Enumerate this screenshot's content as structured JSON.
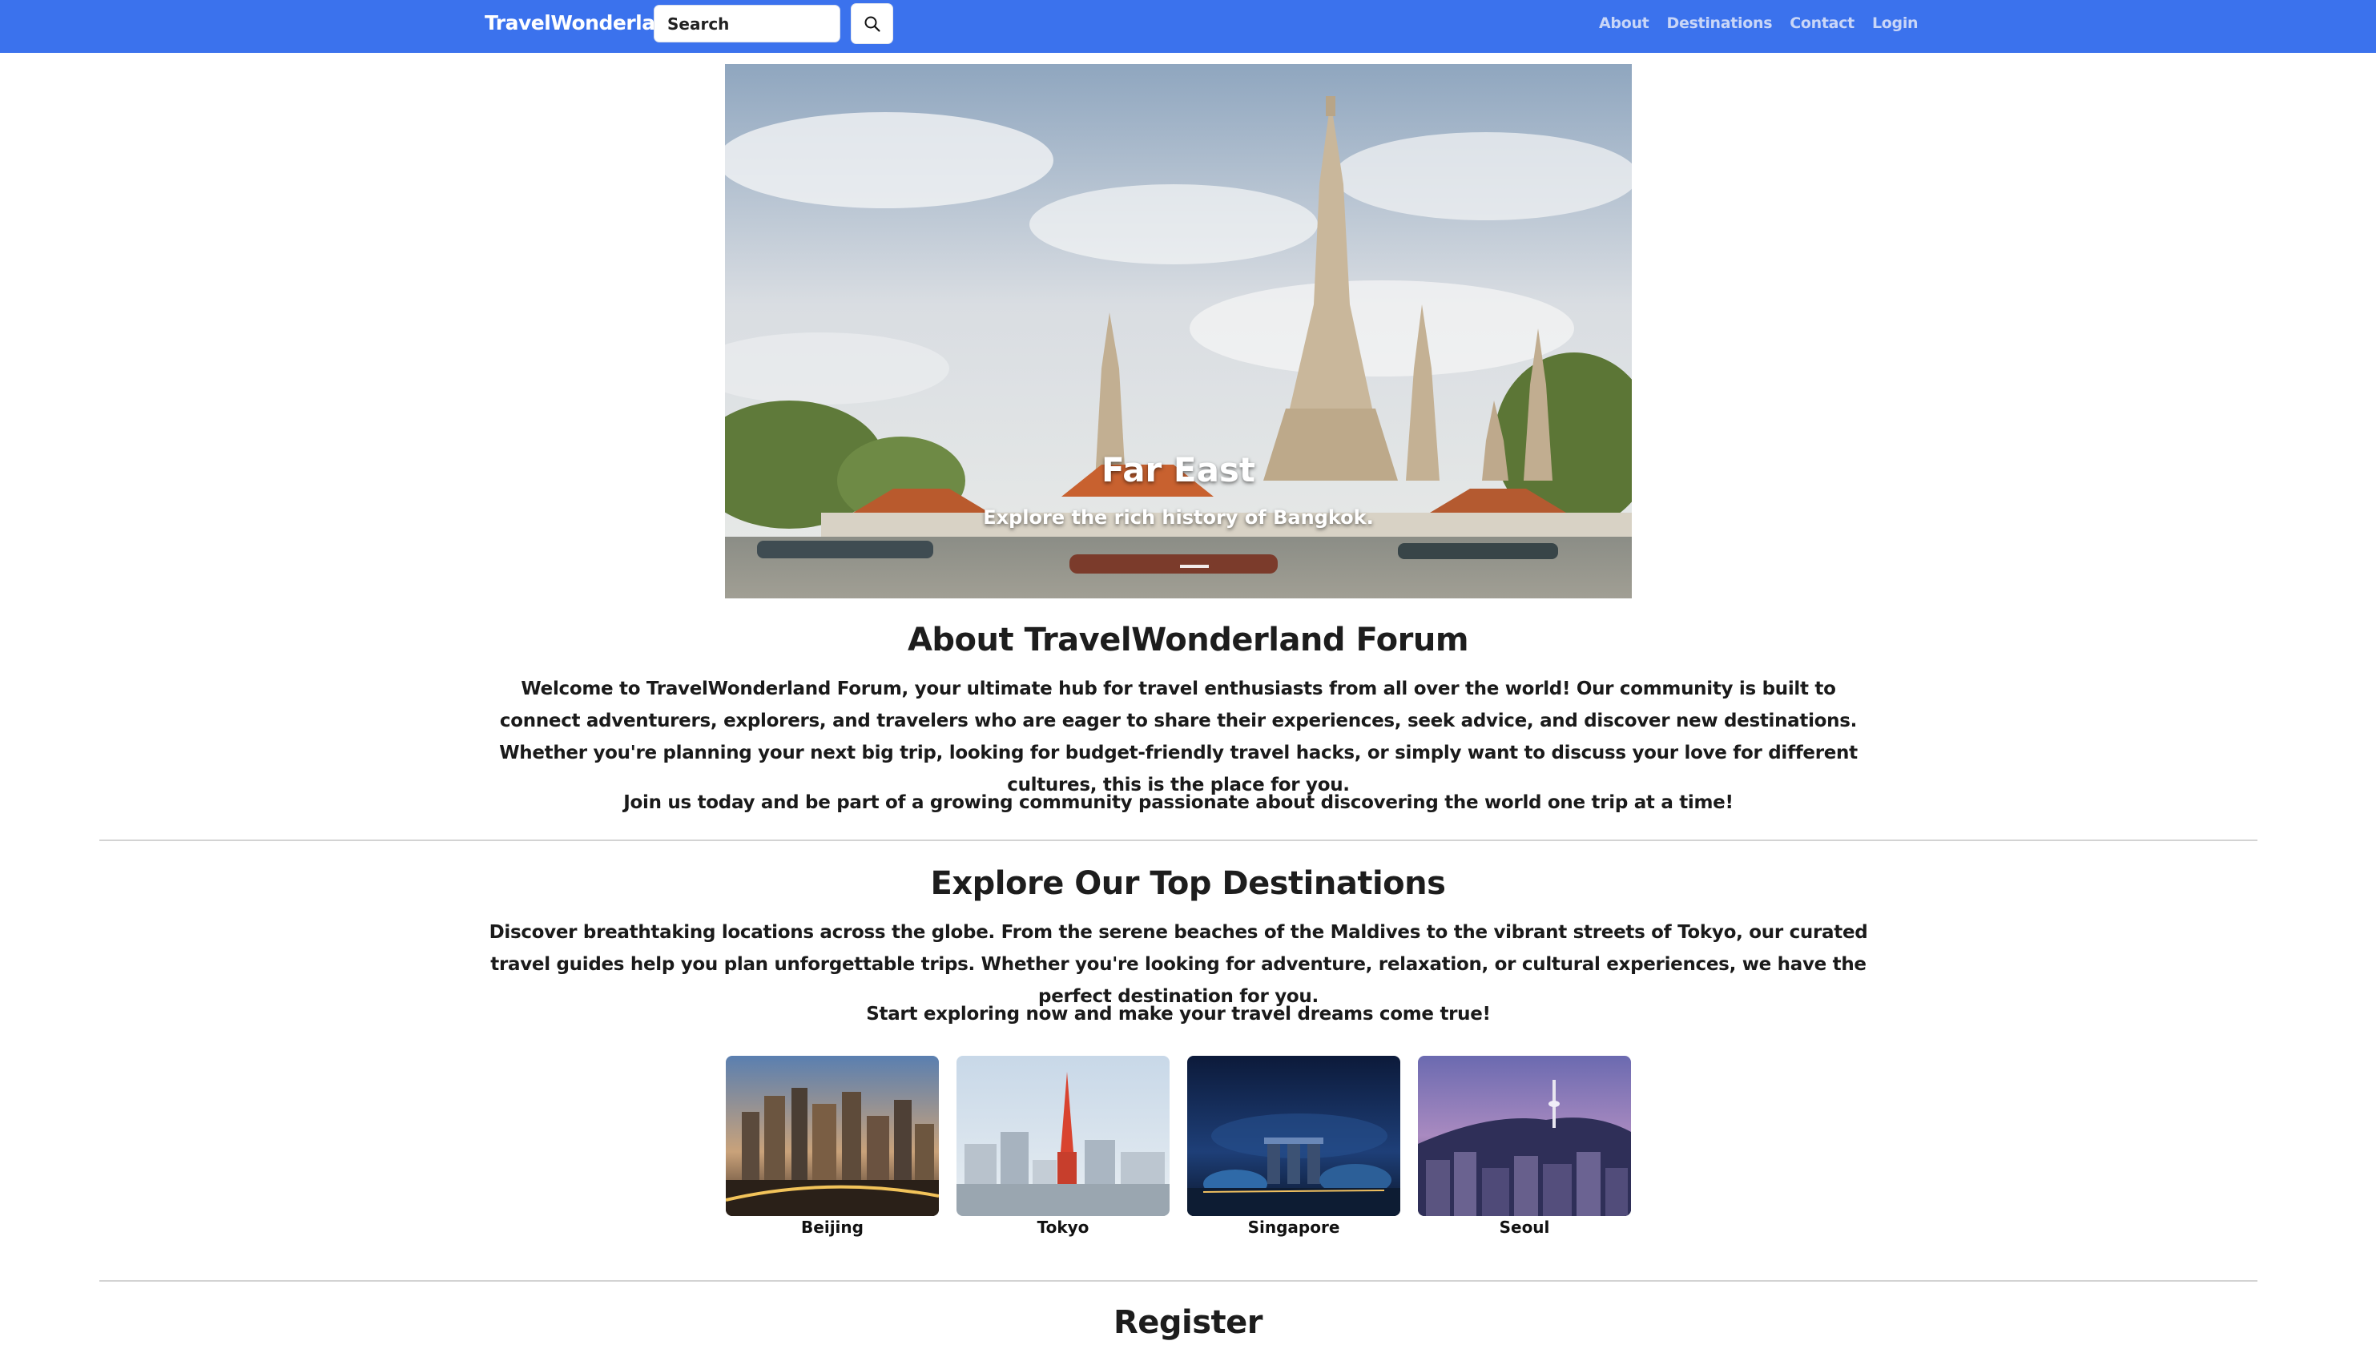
{
  "navbar": {
    "brand": "TravelWonderland",
    "search_placeholder": "Search",
    "links": [
      "About",
      "Destinations",
      "Contact",
      "Login"
    ],
    "background_color": "#3b72ed"
  },
  "hero": {
    "title": "Far East",
    "subtitle": "Explore the rich history of Bangkok."
  },
  "about": {
    "title": "About TravelWonderland Forum",
    "paragraph1": "Welcome to TravelWonderland Forum, your ultimate hub for travel enthusiasts from all over the world! Our community is built to connect adventurers, explorers, and travelers who are eager to share their experiences, seek advice, and discover new destinations. Whether you're planning your next big trip, looking for budget-friendly travel hacks, or simply want to discuss your love for different cultures, this is the place for you.",
    "paragraph2": "Join us today and be part of a growing community passionate about discovering the world one trip at a time!"
  },
  "destinations": {
    "title": "Explore Our Top Destinations",
    "paragraph1": "Discover breathtaking locations across the globe. From the serene beaches of the Maldives to the vibrant streets of Tokyo, our curated travel guides help you plan unforgettable trips. Whether you're looking for adventure, relaxation, or cultural experiences, we have the perfect destination for you.",
    "paragraph2": "Start exploring now and make your travel dreams come true!",
    "items": [
      {
        "label": "Beijing"
      },
      {
        "label": "Tokyo"
      },
      {
        "label": "Singapore"
      },
      {
        "label": "Seoul"
      }
    ]
  },
  "register": {
    "title": "Register"
  },
  "icons": {
    "search": "search-icon"
  }
}
